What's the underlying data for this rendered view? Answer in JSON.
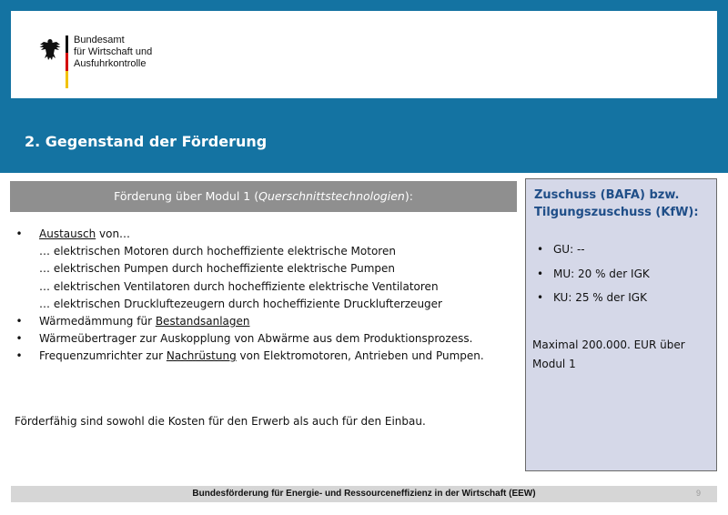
{
  "header": {
    "org_lines": [
      "Bundesamt",
      "für Wirtschaft und",
      "Ausfuhrkontrolle"
    ],
    "flag_colors": [
      "#111111",
      "#d40000",
      "#f2c200"
    ],
    "band_color": "#1473a2",
    "title": "2. Gegenstand der Förderung"
  },
  "left": {
    "heading_prefix": "Förderung über Modul 1 (",
    "heading_italic": "Querschnittstechnologien",
    "heading_suffix": "):",
    "bullet_symbol": "•",
    "item1_link": "Austausch",
    "item1_rest": " von…",
    "sub_items": [
      "… elektrischen Motoren durch hocheffiziente elektrische Motoren",
      "… elektrischen Pumpen durch hocheffiziente elektrische Pumpen",
      "… elektrischen Ventilatoren durch hocheffiziente elektrische Ventilatoren",
      "… elektrischen Druckluftezeugern durch hocheffiziente Drucklufterzeuger"
    ],
    "item2_prefix": "Wärmedämmung für ",
    "item2_link": "Bestandsanlagen",
    "item3": "Wärmeübertrager zur Auskopplung von Abwärme aus dem Produktionsprozess.",
    "item4_prefix": "Frequenzumrichter zur ",
    "item4_link": "Nachrüstung",
    "item4_suffix": " von Elektromotoren, Antrieben und Pumpen.",
    "note": "Förderfähig sind sowohl die Kosten für den Erwerb als auch für den Einbau."
  },
  "right": {
    "heading_line1": "Zuschuss (BAFA) bzw.",
    "heading_line2": "Tilgungszuschuss (KfW):",
    "bullet_symbol": "•",
    "items": [
      "GU:  --",
      "MU: 20 % der IGK",
      "KU:  25 % der IGK"
    ],
    "max_line1": "Maximal 200.000. EUR über",
    "max_line2": "Modul 1"
  },
  "footer": {
    "text": "Bundesförderung für Energie- und Ressourceneffizienz in der Wirtschaft (EEW)",
    "page_number": "9"
  }
}
